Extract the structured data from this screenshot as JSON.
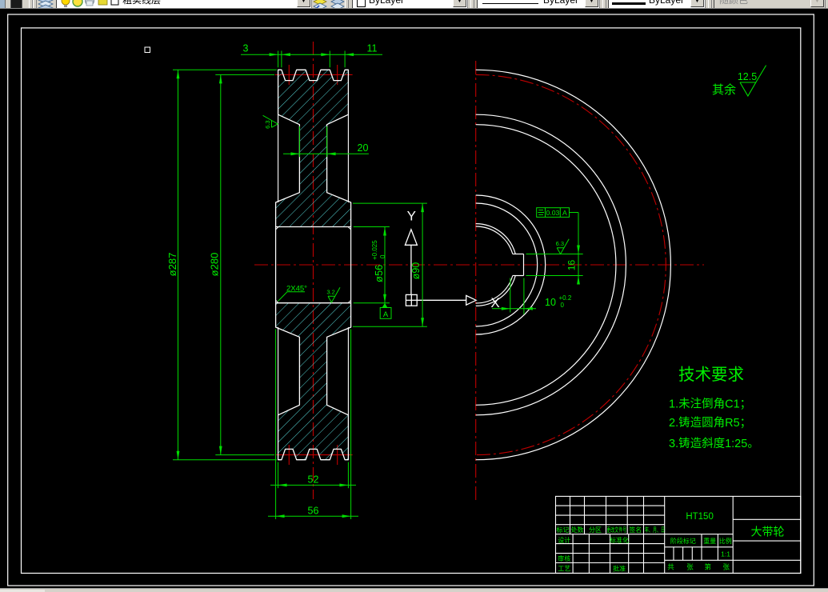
{
  "toolbar": {
    "layer_combo": {
      "value": "粗实线层"
    },
    "color_combo": {
      "value": "ByLayer"
    },
    "linetype_combo": {
      "value": "ByLayer"
    },
    "lineweight_combo": {
      "value": "ByLayer"
    },
    "plotstyle_combo": {
      "value": "随颜色"
    }
  },
  "colors": {
    "outline": "#ffffff",
    "dimension": "#00dd00",
    "centerline": "#c00000",
    "hatch": "#55d4d4",
    "toolbar_bg": "#d5d2ca"
  },
  "drawing": {
    "surface_note": {
      "prefix": "其余",
      "value": "12.5"
    },
    "tech_requirements": {
      "title": "技术要求",
      "item1": "1.未注倒角C1；",
      "item2": "2.铸造圆角R5；",
      "item3": "3.铸造斜度1:25。"
    },
    "dimensions": {
      "groove_edge": "3",
      "groove_width": "11",
      "web_thickness": "20",
      "outer_dia": "ø287",
      "pitch_dia": "ø280",
      "hub_dia": "ø90",
      "bore_dia": "ø56",
      "bore_tol_up": "+0.025",
      "bore_tol_dn": "0",
      "rim_width": "52",
      "hub_width": "56",
      "keyway_width": "16",
      "keyway_depth": "10",
      "keyway_tol_up": "+0.2",
      "keyway_tol_dn": "0",
      "chamfer_note": "2X45°"
    },
    "roughness": {
      "rim_side": "6.3",
      "bore": "3.2",
      "keyway": "6.3"
    },
    "gdt": {
      "tolerance": "0.03",
      "datum_ref": "A",
      "datum_label": "A"
    },
    "ucs": {
      "x_label": "X",
      "y_label": "Y"
    }
  },
  "title_block": {
    "material": "HT150",
    "part_name": "大带轮",
    "scale_value": "1:1",
    "col_mark": "标记",
    "col_count": "处数",
    "col_zone": "分区",
    "col_docno": "更改文件号",
    "col_sign": "签名",
    "col_date": "年、月、日",
    "row_design": "设计",
    "row_check": "审核",
    "row_process": "工艺",
    "row_standard": "标准化",
    "row_approve": "批准",
    "stage_header": "阶段标记",
    "weight_header": "重量",
    "scale_header": "比例",
    "sheet_total_label": "共",
    "sheet_total_unit": "张",
    "sheet_no_label": "第",
    "sheet_no_unit": "张"
  }
}
